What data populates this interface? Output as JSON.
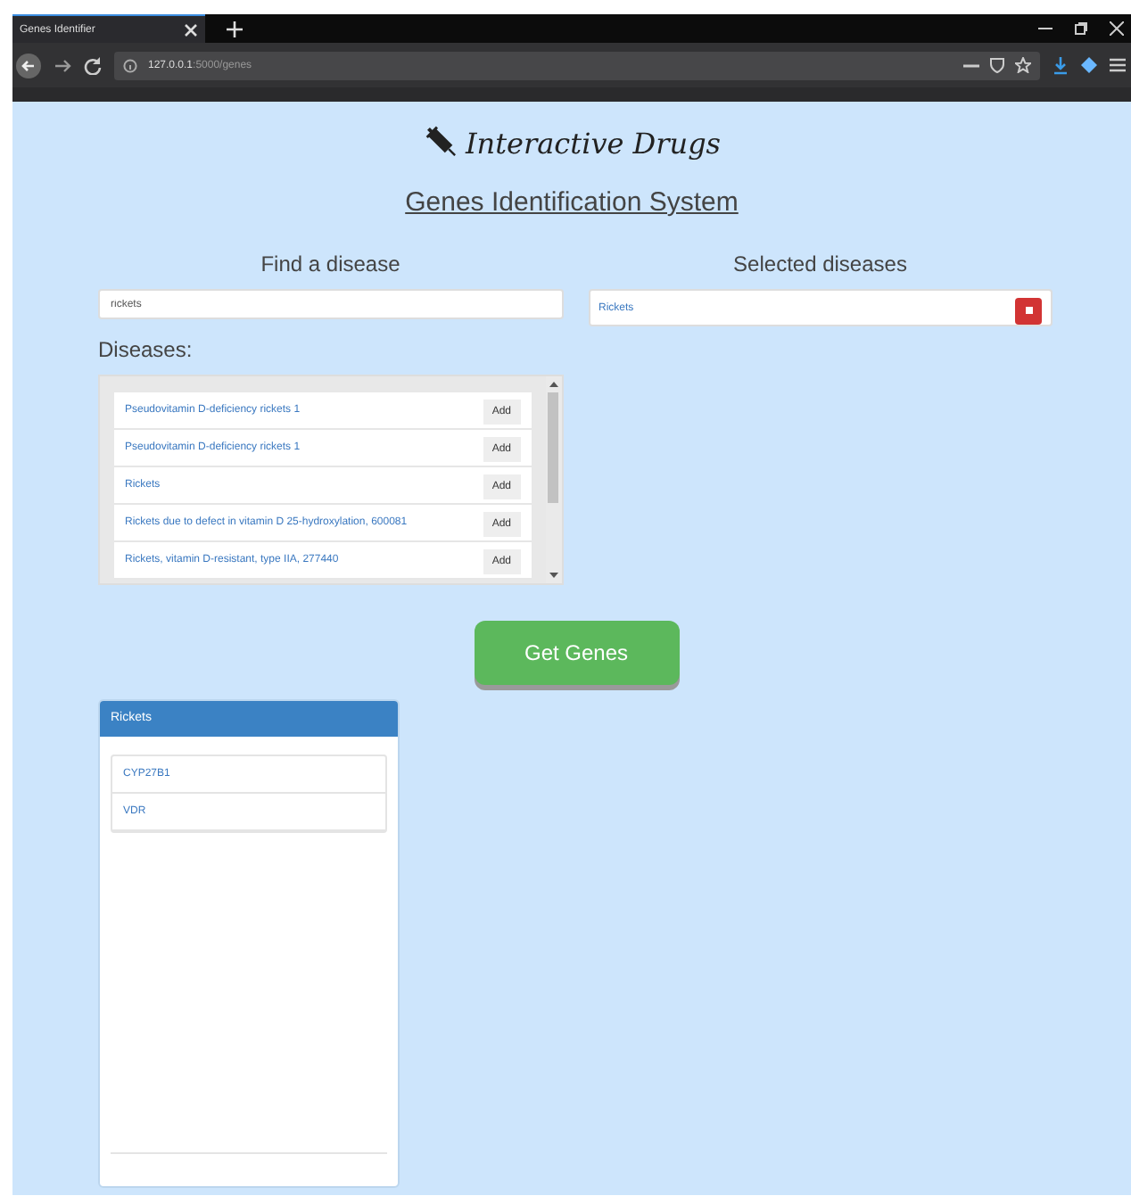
{
  "browser": {
    "tab_title": "Genes Identifier",
    "url_host": "127.0.0.1",
    "url_path": ":5000/genes"
  },
  "logo": {
    "text": "Interactive Drugs"
  },
  "page_title": "Genes Identification System",
  "find": {
    "heading": "Find a disease",
    "value": "rickets"
  },
  "selected": {
    "heading": "Selected diseases",
    "items": [
      {
        "name": "Rickets"
      }
    ]
  },
  "diseases": {
    "heading": "Diseases:",
    "items": [
      {
        "name": "Pseudovitamin D-deficiency rickets 1",
        "button": "Add"
      },
      {
        "name": "Pseudovitamin D-deficiency rickets 1",
        "button": "Add"
      },
      {
        "name": "Rickets",
        "button": "Add"
      },
      {
        "name": "Rickets due to defect in vitamin D 25-hydroxylation, 600081",
        "button": "Add"
      },
      {
        "name": "Rickets, vitamin D-resistant, type IIA, 277440",
        "button": "Add"
      }
    ]
  },
  "action": "Get Genes",
  "results": [
    {
      "disease": "Rickets",
      "genes": [
        "CYP27B1",
        "VDR"
      ]
    }
  ]
}
